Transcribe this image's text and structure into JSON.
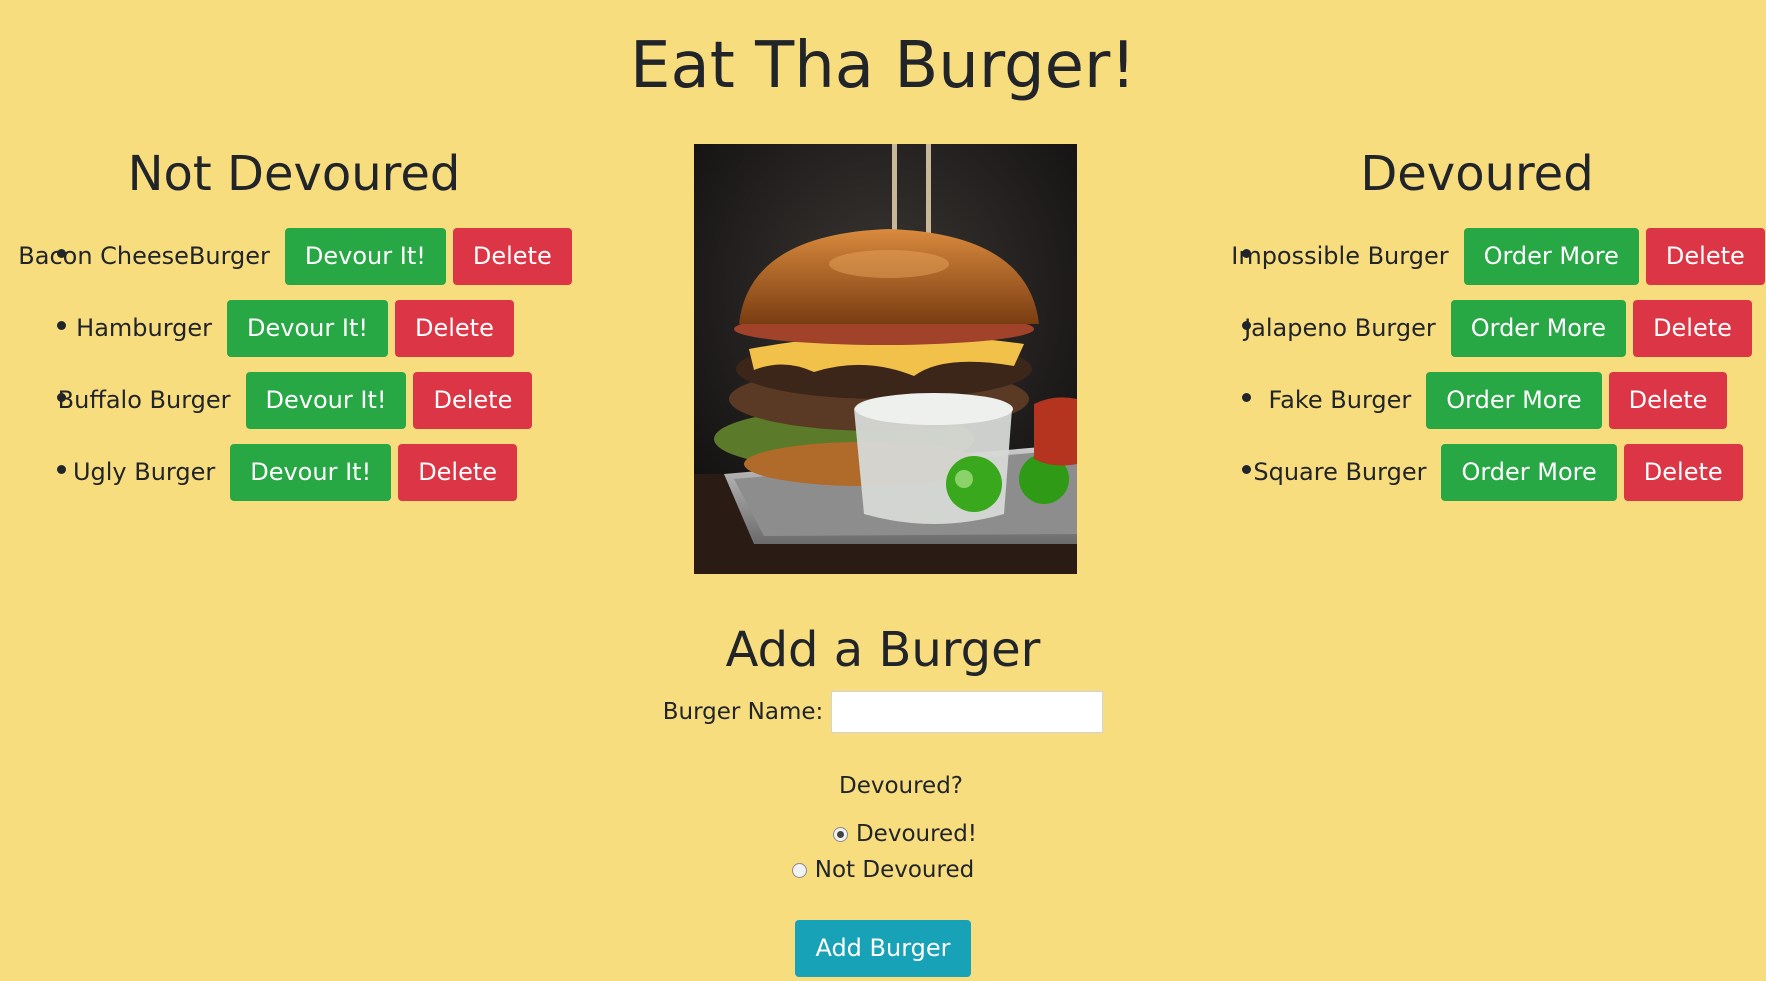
{
  "page": {
    "title": "Eat Tha Burger!"
  },
  "not_devoured": {
    "heading": "Not Devoured",
    "items": [
      {
        "name": "Bacon CheeseBurger",
        "action_label": "Devour It!",
        "delete_label": "Delete"
      },
      {
        "name": "Hamburger",
        "action_label": "Devour It!",
        "delete_label": "Delete"
      },
      {
        "name": "Buffalo Burger",
        "action_label": "Devour It!",
        "delete_label": "Delete"
      },
      {
        "name": "Ugly Burger",
        "action_label": "Devour It!",
        "delete_label": "Delete"
      }
    ]
  },
  "devoured": {
    "heading": "Devoured",
    "items": [
      {
        "name": "Impossible Burger",
        "action_label": "Order More",
        "delete_label": "Delete"
      },
      {
        "name": "Jalapeno Burger",
        "action_label": "Order More",
        "delete_label": "Delete"
      },
      {
        "name": "Fake Burger",
        "action_label": "Order More",
        "delete_label": "Delete"
      },
      {
        "name": "Square Burger",
        "action_label": "Order More",
        "delete_label": "Delete"
      }
    ]
  },
  "add_form": {
    "heading": "Add a Burger",
    "name_label": "Burger Name:",
    "name_value": "",
    "devoured_question": "Devoured?",
    "options": [
      {
        "label": "Devoured!",
        "checked": true
      },
      {
        "label": "Not Devoured",
        "checked": false
      }
    ],
    "submit_label": "Add Burger"
  },
  "colors": {
    "background": "#f8dd7f",
    "success": "#28a745",
    "danger": "#dc3545",
    "info": "#17a2b8"
  }
}
